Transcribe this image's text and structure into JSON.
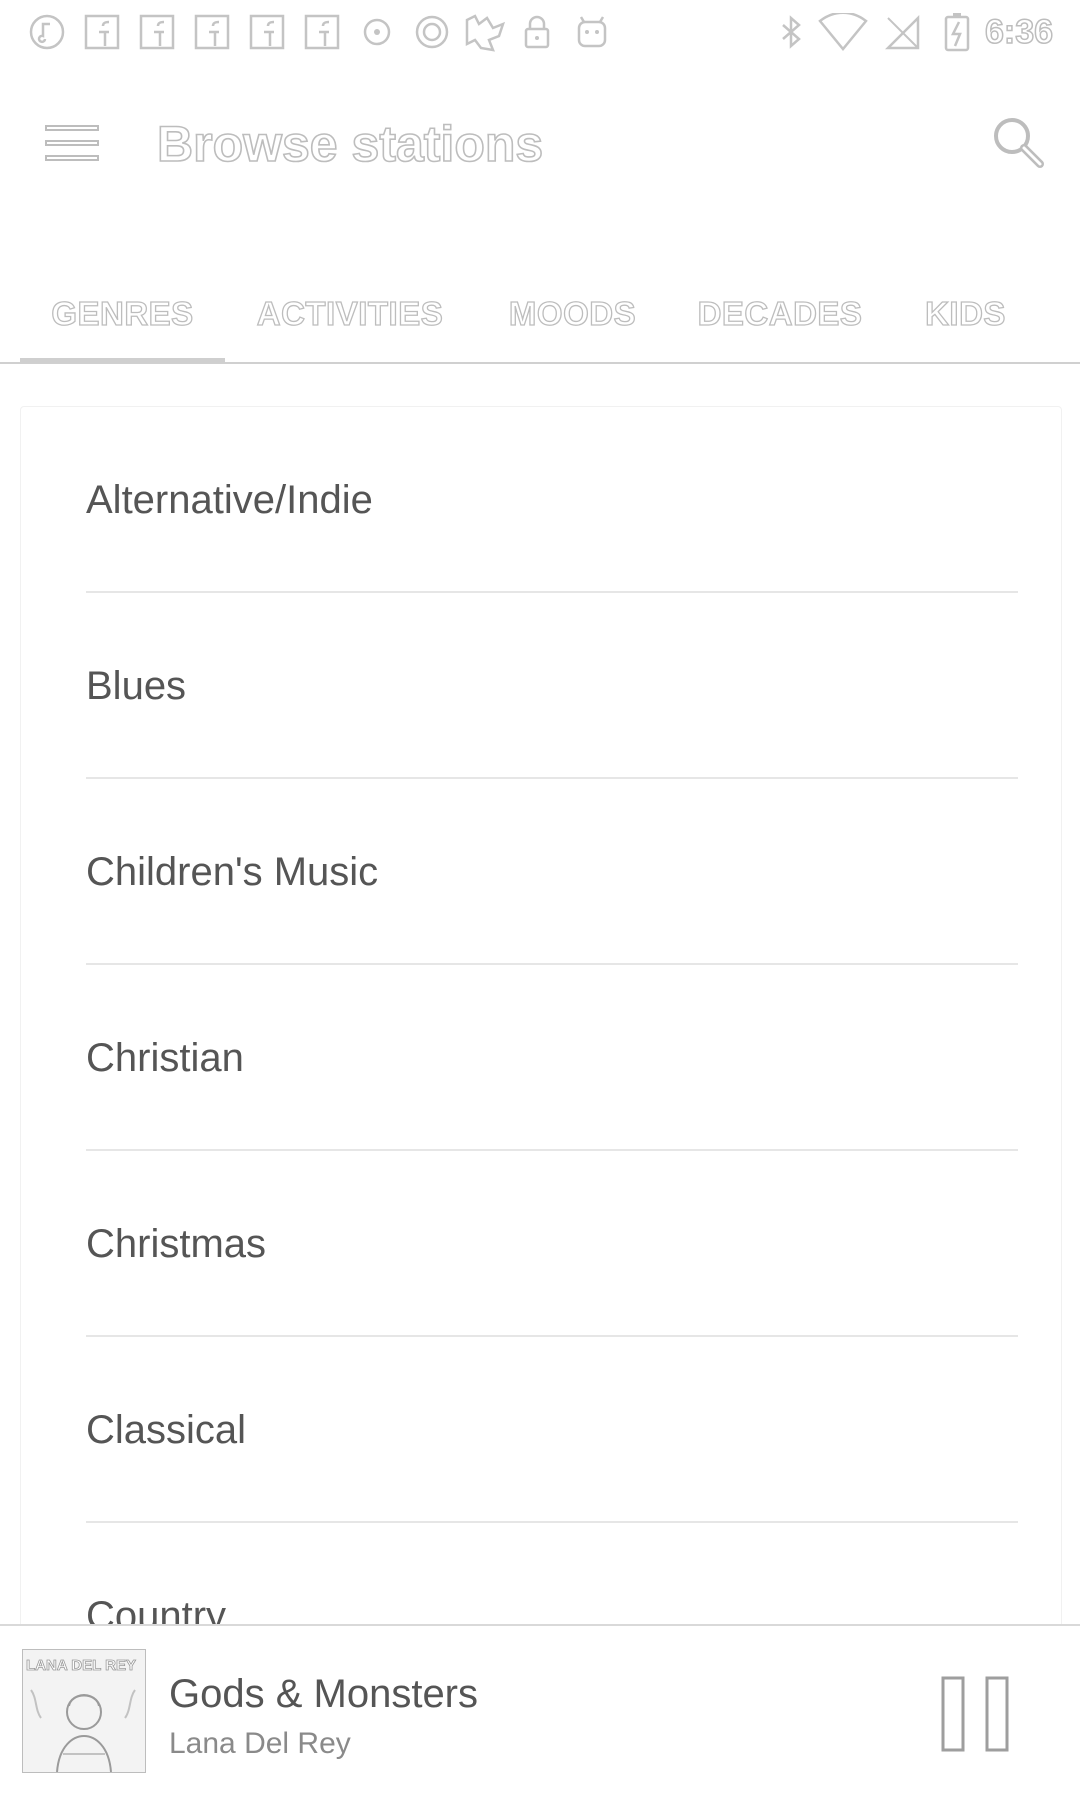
{
  "status_bar": {
    "icons": [
      "music-note-icon",
      "facebook-icon",
      "facebook-icon",
      "facebook-icon",
      "facebook-icon",
      "facebook-icon",
      "record-icon",
      "circle-icon",
      "fun-app-icon",
      "lock-icon",
      "android-icon",
      "bluetooth-icon",
      "wifi-icon",
      "no-sim-icon",
      "battery-charging-icon"
    ],
    "time": "6:36"
  },
  "app_bar": {
    "menu_icon": "hamburger-menu-icon",
    "title": "Browse stations",
    "search_icon": "search-icon"
  },
  "tabs": [
    {
      "label": "GENRES",
      "selected": true
    },
    {
      "label": "ACTIVITIES",
      "selected": false
    },
    {
      "label": "MOODS",
      "selected": false
    },
    {
      "label": "DECADES",
      "selected": false
    },
    {
      "label": "KIDS",
      "selected": false
    }
  ],
  "genres": [
    {
      "label": "Alternative/Indie"
    },
    {
      "label": "Blues"
    },
    {
      "label": "Children's Music"
    },
    {
      "label": "Christian"
    },
    {
      "label": "Christmas"
    },
    {
      "label": "Classical"
    },
    {
      "label": "Country"
    }
  ],
  "now_playing": {
    "title": "Gods & Monsters",
    "artist": "Lana Del Rey",
    "art_text": "LANA DEL REY",
    "pause_icon": "pause-icon"
  }
}
